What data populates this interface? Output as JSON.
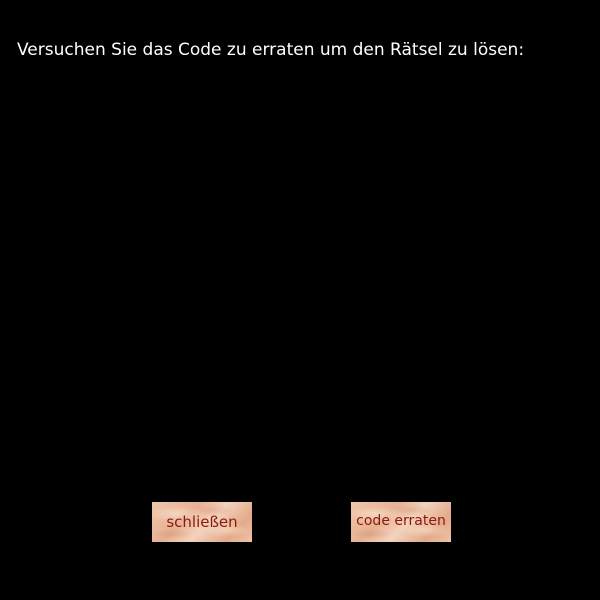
{
  "dialog": {
    "prompt": "Versuchen Sie das Code zu erraten um den Rätsel zu lösen:",
    "close_label": "schließen",
    "guess_label": "code erraten"
  },
  "colors": {
    "background": "#000000",
    "text": "#ffffff",
    "button_text": "#8b1a10",
    "button_bg": "#e7b193"
  }
}
